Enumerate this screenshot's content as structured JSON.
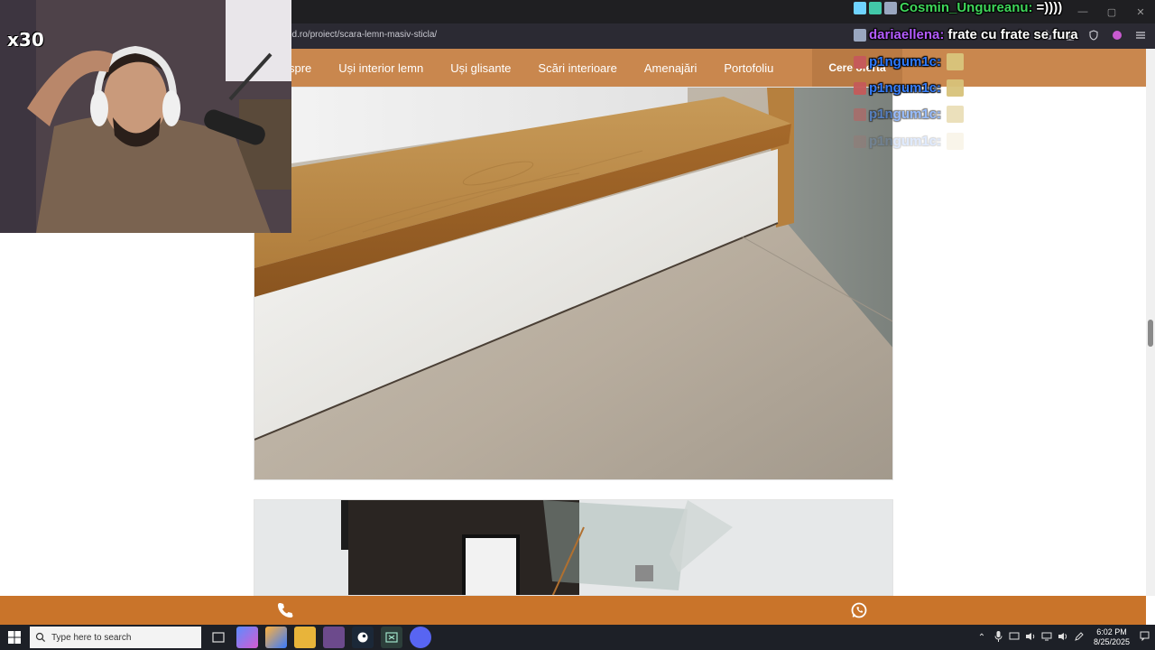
{
  "browser": {
    "url": "od.ro/proiect/scara-lemn-masiv-sticla/",
    "window_controls": [
      "—",
      "▢",
      "✕"
    ]
  },
  "site": {
    "nav_items": [
      "spre",
      "Uși interior lemn",
      "Uși glisante",
      "Scări interioare",
      "Amenajări",
      "Portofoliu"
    ],
    "cta_label": "Cere ofertă",
    "accent_color": "#c9874e",
    "contact_bar_color": "#c9742a"
  },
  "contact_bar": {
    "phone_icon": "phone-icon",
    "whatsapp_icon": "whatsapp-icon"
  },
  "taskbar": {
    "search_placeholder": "Type here to search",
    "time": "6:02 PM",
    "date": "8/25/2025"
  },
  "stream": {
    "badge": "x30",
    "chat": [
      {
        "user": "Cosmin_Ungureanu:",
        "message": "=))))",
        "user_color": "#3fd65a",
        "message_color": "#ffffff",
        "opacity": 1
      },
      {
        "user": "dariaellena:",
        "message": "frate cu frate se fura",
        "user_color": "#b45cff",
        "message_color": "#ffffff",
        "opacity": 1
      },
      {
        "user": "p1ngum1c:",
        "message": "",
        "user_color": "#2f7bff",
        "message_color": "#ffffff",
        "opacity": 1
      },
      {
        "user": "p1ngum1c:",
        "message": "",
        "user_color": "#2f7bff",
        "message_color": "#ffffff",
        "opacity": 0.95
      },
      {
        "user": "p1ngum1c:",
        "message": "",
        "user_color": "#2f7bff",
        "message_color": "#ffffff",
        "opacity": 0.5
      },
      {
        "user": "p1ngum1c:",
        "message": "",
        "user_color": "#2f7bff",
        "message_color": "#ffffff",
        "opacity": 0.15
      }
    ]
  }
}
